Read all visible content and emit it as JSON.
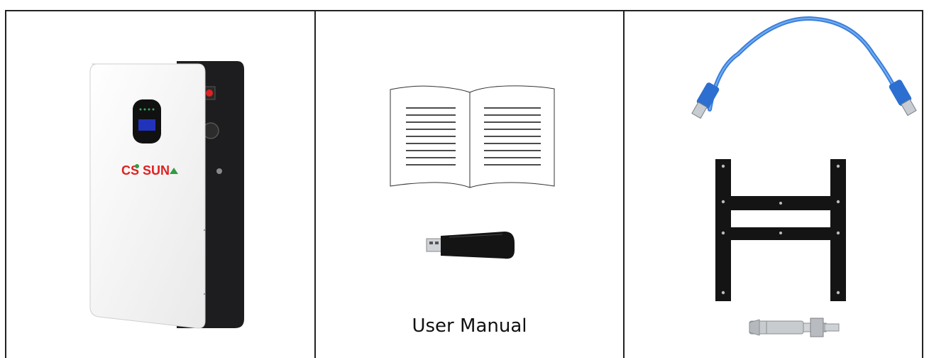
{
  "brand_logo": {
    "text": "CS SUN",
    "color_primary": "#e02020",
    "color_accent": "#2e9e3e"
  },
  "cells": [
    {
      "item": "battery-unit",
      "caption": ""
    },
    {
      "item": "user-manual-and-usb-dongle",
      "caption": "User Manual"
    },
    {
      "item": "usb-cable-bracket-anchor-bolt",
      "caption": ""
    }
  ]
}
